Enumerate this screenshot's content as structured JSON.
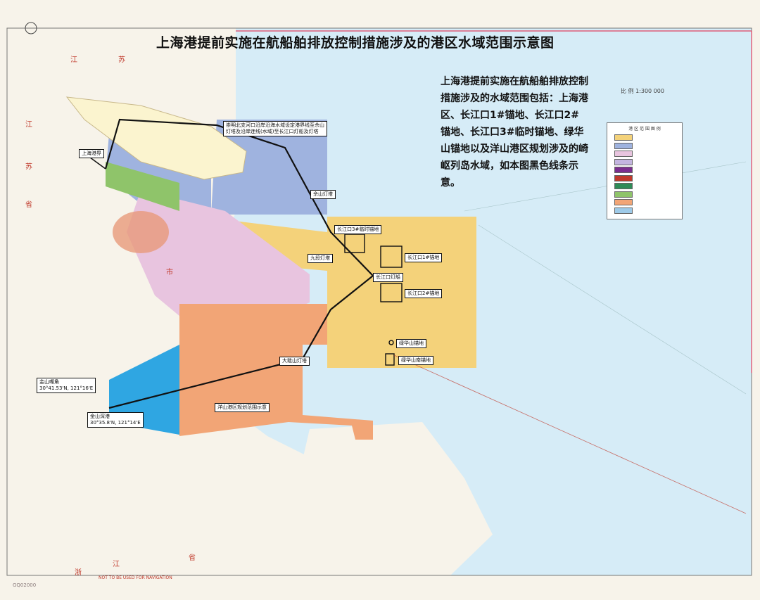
{
  "map": {
    "title": "上海港提前实施在航船舶排放控制措施涉及的港区水域范围示意图",
    "description": "上海港提前实施在航船舶排放控制措施涉及的水域范围包括：上海港区、长江口1#锚地、长江口2#锚地、长江口3#临时锚地、绿华山锚地以及洋山港区规划涉及的崎岖列岛水域，如本图黑色线条示意。",
    "scale_text": "比 例 1:300 000",
    "colors": {
      "sea": "#d6ecf7",
      "land": "#f7f3ea",
      "yellow_zone": "#f4d27a",
      "blue_zone": "#9fb3df",
      "orange_zone": "#f2a576",
      "pink_zone": "#e8c4df",
      "purple_zone": "#c4b5e0",
      "green_zone": "#8fc46a",
      "cyan_zone": "#2fa6e2",
      "boundary_line": "#111111"
    },
    "labels": {
      "shanghai_port": "上海港界",
      "north_channel": "崇明北支河口沿岸沿海水域设定港界线至佘山灯塔及沿岸连线(水域)至长江口灯船及灯塔",
      "sheshan": "佘山灯塔",
      "anchorage3": "长江口3#临时锚地",
      "anchorage1": "长江口1#锚地",
      "lightship": "长江口灯船",
      "anchorage2": "长江口2#锚地",
      "jiuduan": "九段灯塔",
      "lvhua_anchorage": "绿华山锚地",
      "lvhua_south": "绿华山南锚地",
      "dajishan": "大戢山灯塔",
      "yangshan": "洋山港区规划范围示意",
      "jinshan": "金山嘴角",
      "jinshan_coord": "30°41.53'N, 121°16'E",
      "jinshan_port": "金山深港",
      "jinshan_port_coord": "30°35.8'N, 121°14'E"
    },
    "places": {
      "jiangsu_a": "江",
      "jiangsu_b": "苏",
      "jiangsu_c": "江",
      "jiangsu_d": "苏",
      "sheng_a": "省",
      "shanghai_shi": "市",
      "zhejiang_a": "浙",
      "zhejiang_b": "江",
      "zhejiang_c": "省"
    },
    "legend": {
      "title": "港 区 范 围 图 例",
      "items": [
        {
          "label": "",
          "color": "#f4d27a"
        },
        {
          "label": "",
          "color": "#9fb3df"
        },
        {
          "label": "",
          "color": "#e8c4df"
        },
        {
          "label": "",
          "color": "#c4b5e0"
        },
        {
          "label": "",
          "color": "#7b2e8e"
        },
        {
          "label": "",
          "color": "#c0392b"
        },
        {
          "label": "",
          "color": "#2e8b57"
        },
        {
          "label": "",
          "color": "#8fc46a"
        },
        {
          "label": "",
          "color": "#f2a576"
        },
        {
          "label": "",
          "color": "#9ecae8"
        }
      ]
    },
    "corner_code": "GQ02000",
    "footer": "NOT TO BE USED FOR NAVIGATION"
  }
}
